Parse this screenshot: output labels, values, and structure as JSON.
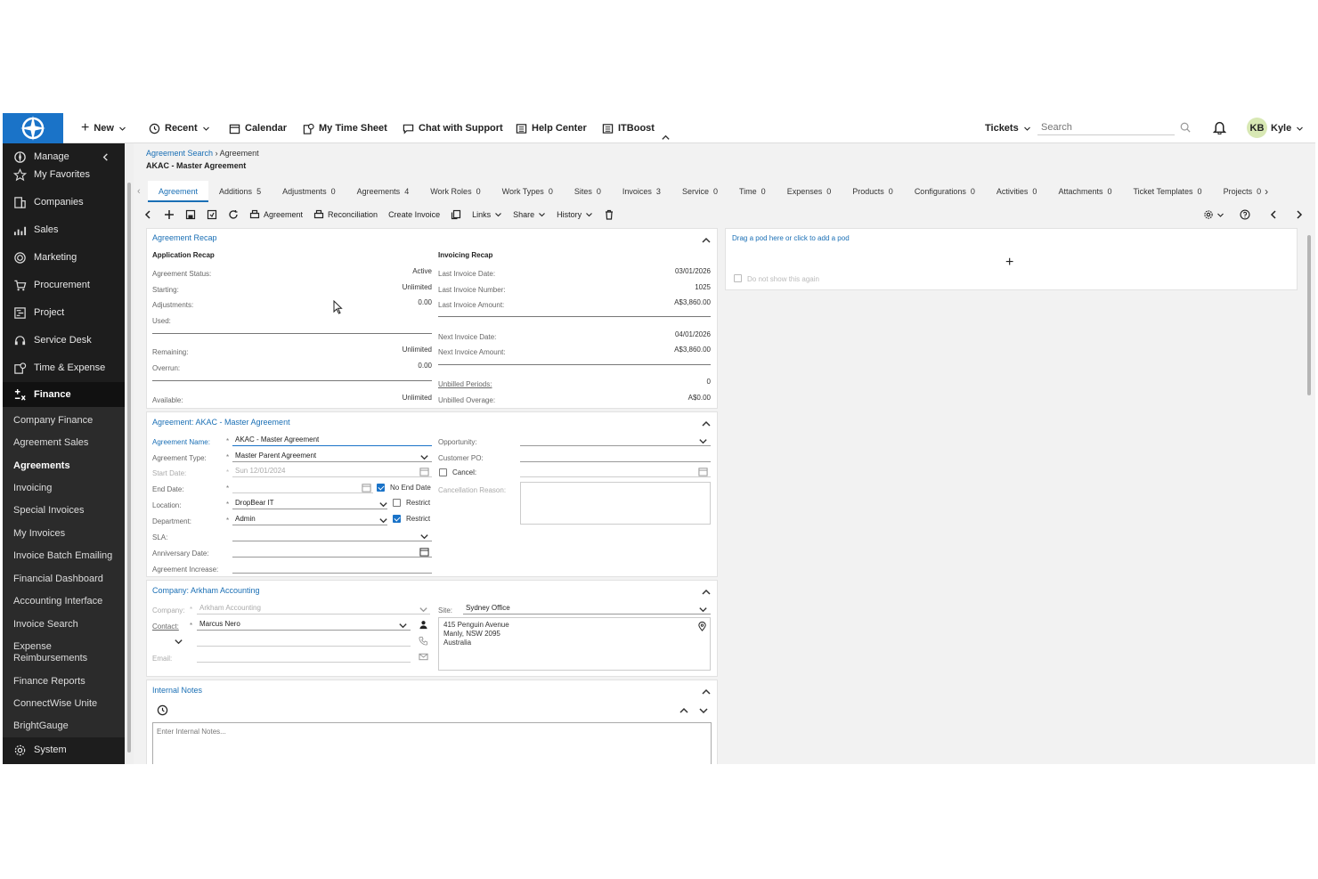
{
  "topbar": {
    "new": "New",
    "recent": "Recent",
    "calendar": "Calendar",
    "timesheet": "My Time Sheet",
    "chat": "Chat with Support",
    "help": "Help Center",
    "itboost": "ITBoost",
    "tickets": "Tickets",
    "search_placeholder": "Search",
    "avatar": "KB",
    "user": "Kyle"
  },
  "sidebar": {
    "main": [
      "Manage",
      "My Favorites",
      "Companies",
      "Sales",
      "Marketing",
      "Procurement",
      "Project",
      "Service Desk",
      "Time & Expense",
      "Finance"
    ],
    "finance_items": [
      "Company Finance",
      "Agreement Sales",
      "Agreements",
      "Invoicing",
      "Special Invoices",
      "My Invoices",
      "Invoice Batch Emailing",
      "Financial Dashboard",
      "Accounting Interface",
      "Invoice Search",
      "Expense Reimbursements",
      "Finance Reports",
      "ConnectWise Unite",
      "BrightGauge"
    ],
    "system": "System"
  },
  "breadcrumb": {
    "link": "Agreement Search",
    "current": "Agreement",
    "title": "AKAC - Master Agreement"
  },
  "tabs": [
    {
      "label": "Agreement",
      "count": ""
    },
    {
      "label": "Additions",
      "count": "5"
    },
    {
      "label": "Adjustments",
      "count": "0"
    },
    {
      "label": "Agreements",
      "count": "4"
    },
    {
      "label": "Work Roles",
      "count": "0"
    },
    {
      "label": "Work Types",
      "count": "0"
    },
    {
      "label": "Sites",
      "count": "0"
    },
    {
      "label": "Invoices",
      "count": "3"
    },
    {
      "label": "Service",
      "count": "0"
    },
    {
      "label": "Time",
      "count": "0"
    },
    {
      "label": "Expenses",
      "count": "0"
    },
    {
      "label": "Products",
      "count": "0"
    },
    {
      "label": "Configurations",
      "count": "0"
    },
    {
      "label": "Activities",
      "count": "0"
    },
    {
      "label": "Attachments",
      "count": "0"
    },
    {
      "label": "Ticket Templates",
      "count": "0"
    },
    {
      "label": "Projects",
      "count": "0"
    }
  ],
  "toolbar": {
    "agreement": "Agreement",
    "reconciliation": "Reconciliation",
    "create_invoice": "Create Invoice",
    "links": "Links",
    "share": "Share",
    "history": "History"
  },
  "recap": {
    "title": "Agreement Recap",
    "app_header": "Application Recap",
    "inv_header": "Invoicing Recap",
    "status_label": "Agreement Status:",
    "status": "Active",
    "starting_label": "Starting:",
    "starting": "Unlimited",
    "adjust_label": "Adjustments:",
    "adjust": "0.00",
    "used_label": "Used:",
    "remaining_label": "Remaining:",
    "remaining": "Unlimited",
    "overrun_label": "Overrun:",
    "overrun": "0.00",
    "available_label": "Available:",
    "available": "Unlimited",
    "last_date_label": "Last Invoice Date:",
    "last_date": "03/01/2026",
    "last_num_label": "Last Invoice Number:",
    "last_num": "1025",
    "last_amt_label": "Last Invoice Amount:",
    "last_amt": "A$3,860.00",
    "next_date_label": "Next Invoice Date:",
    "next_date": "04/01/2026",
    "next_amt_label": "Next Invoice Amount:",
    "next_amt": "A$3,860.00",
    "unbilled_periods_label": "Unbilled Periods:",
    "unbilled_periods": "0",
    "unbilled_overage_label": "Unbilled Overage:",
    "unbilled_overage": "A$0.00"
  },
  "agreement": {
    "title": "Agreement: AKAC - Master Agreement",
    "name_label": "Agreement Name:",
    "name": "AKAC - Master Agreement",
    "type_label": "Agreement Type:",
    "type": "Master Parent Agreement",
    "start_label": "Start Date:",
    "start": "Sun 12/01/2024",
    "end_label": "End Date:",
    "no_end": "No End Date",
    "location_label": "Location:",
    "location": "DropBear IT",
    "department_label": "Department:",
    "department": "Admin",
    "restrict": "Restrict",
    "sla_label": "SLA:",
    "anniversary_label": "Anniversary Date:",
    "increase_label": "Agreement Increase:",
    "opportunity_label": "Opportunity:",
    "po_label": "Customer PO:",
    "cancel_label": "Cancel:",
    "cancel_reason_label": "Cancellation Reason:"
  },
  "company": {
    "title": "Company: Arkham Accounting",
    "company_label": "Company:",
    "company": "Arkham Accounting",
    "contact_label": "Contact:",
    "contact": "Marcus Nero",
    "email_label": "Email:",
    "site_label": "Site:",
    "site": "Sydney Office",
    "address1": "415 Penguin Avenue",
    "address2": "Manly, NSW 2095",
    "address3": "Australia"
  },
  "notes": {
    "title": "Internal Notes",
    "placeholder": "Enter Internal Notes..."
  },
  "pod": {
    "text": "Drag a pod here or click to add a pod",
    "dont_show": "Do not show this again"
  }
}
